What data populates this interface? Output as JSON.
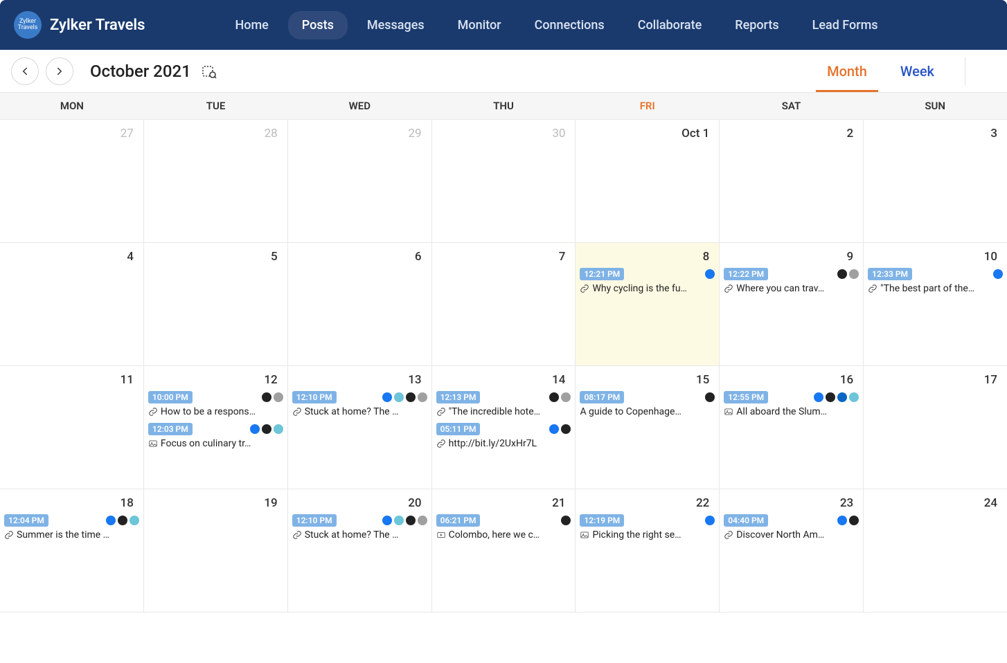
{
  "brand": {
    "name": "Zylker Travels",
    "logo_text": "Zylker Travels"
  },
  "nav": {
    "items": [
      {
        "label": "Home"
      },
      {
        "label": "Posts",
        "active": true
      },
      {
        "label": "Messages"
      },
      {
        "label": "Monitor"
      },
      {
        "label": "Connections"
      },
      {
        "label": "Collaborate"
      },
      {
        "label": "Reports"
      },
      {
        "label": "Lead Forms"
      }
    ]
  },
  "toolbar": {
    "month_label": "October 2021",
    "view_month": "Month",
    "view_week": "Week"
  },
  "calendar": {
    "day_headers": [
      "MON",
      "TUE",
      "WED",
      "THU",
      "FRI",
      "SAT",
      "SUN"
    ],
    "today_col": 4,
    "weeks": [
      {
        "days": [
          {
            "num": "27",
            "other": true,
            "posts": []
          },
          {
            "num": "28",
            "other": true,
            "posts": []
          },
          {
            "num": "29",
            "other": true,
            "posts": []
          },
          {
            "num": "30",
            "other": true,
            "posts": []
          },
          {
            "num": "Oct 1",
            "current": true,
            "posts": []
          },
          {
            "num": "2",
            "current": true,
            "posts": []
          },
          {
            "num": "3",
            "current": true,
            "posts": []
          }
        ]
      },
      {
        "days": [
          {
            "num": "4",
            "current": true,
            "posts": []
          },
          {
            "num": "5",
            "current": true,
            "posts": []
          },
          {
            "num": "6",
            "current": true,
            "posts": []
          },
          {
            "num": "7",
            "current": true,
            "posts": []
          },
          {
            "num": "8",
            "current": true,
            "today": true,
            "posts": [
              {
                "time": "12:21 PM",
                "icon": "link",
                "title": "Why cycling is the fu…",
                "nets": [
                  "fb"
                ]
              }
            ]
          },
          {
            "num": "9",
            "current": true,
            "posts": [
              {
                "time": "12:22 PM",
                "icon": "link",
                "title": "Where you can trav…",
                "nets": [
                  "x",
                  "gm"
                ]
              }
            ]
          },
          {
            "num": "10",
            "current": true,
            "posts": [
              {
                "time": "12:33 PM",
                "icon": "link",
                "title": "\"The best part of the…",
                "nets": [
                  "fb"
                ]
              }
            ]
          }
        ]
      },
      {
        "days": [
          {
            "num": "11",
            "current": true,
            "posts": []
          },
          {
            "num": "12",
            "current": true,
            "posts": [
              {
                "time": "10:00 PM",
                "icon": "link",
                "title": "How to be a respons…",
                "nets": [
                  "x",
                  "gm"
                ]
              },
              {
                "time": "12:03 PM",
                "icon": "image",
                "title": "Focus on culinary tr…",
                "nets": [
                  "fb",
                  "x",
                  "pb"
                ]
              }
            ]
          },
          {
            "num": "13",
            "current": true,
            "posts": [
              {
                "time": "12:10 PM",
                "icon": "link",
                "title": "Stuck at home? The …",
                "nets": [
                  "fb",
                  "pb",
                  "x",
                  "gm"
                ]
              }
            ]
          },
          {
            "num": "14",
            "current": true,
            "posts": [
              {
                "time": "12:13 PM",
                "icon": "link",
                "title": "\"The incredible hote…",
                "nets": [
                  "x",
                  "gm"
                ]
              },
              {
                "time": "05:11 PM",
                "icon": "link",
                "title": "http://bit.ly/2UxHr7L",
                "nets": [
                  "fb",
                  "x"
                ]
              }
            ]
          },
          {
            "num": "15",
            "current": true,
            "posts": [
              {
                "time": "08:17 PM",
                "icon": "none",
                "title": "A guide to Copenhage…",
                "nets": [
                  "x"
                ]
              }
            ]
          },
          {
            "num": "16",
            "current": true,
            "posts": [
              {
                "time": "12:55 PM",
                "icon": "image",
                "title": "All aboard the Slum…",
                "nets": [
                  "fb",
                  "x",
                  "in",
                  "pb"
                ]
              }
            ]
          },
          {
            "num": "17",
            "current": true,
            "posts": []
          }
        ]
      },
      {
        "days": [
          {
            "num": "18",
            "current": true,
            "posts": [
              {
                "time": "12:04 PM",
                "icon": "link",
                "title": "Summer is the time …",
                "nets": [
                  "fb",
                  "x",
                  "pb"
                ]
              }
            ]
          },
          {
            "num": "19",
            "current": true,
            "posts": []
          },
          {
            "num": "20",
            "current": true,
            "posts": [
              {
                "time": "12:10 PM",
                "icon": "link",
                "title": "Stuck at home? The …",
                "nets": [
                  "fb",
                  "pb",
                  "x",
                  "gm"
                ]
              }
            ]
          },
          {
            "num": "21",
            "current": true,
            "posts": [
              {
                "time": "06:21 PM",
                "icon": "video",
                "title": "Colombo, here we c…",
                "nets": [
                  "x"
                ]
              }
            ]
          },
          {
            "num": "22",
            "current": true,
            "posts": [
              {
                "time": "12:19 PM",
                "icon": "image",
                "title": "Picking the right se…",
                "nets": [
                  "fb"
                ]
              }
            ]
          },
          {
            "num": "23",
            "current": true,
            "posts": [
              {
                "time": "04:40 PM",
                "icon": "link",
                "title": "Discover North Am…",
                "nets": [
                  "fb",
                  "x"
                ]
              }
            ]
          },
          {
            "num": "24",
            "current": true,
            "posts": []
          }
        ]
      }
    ]
  }
}
